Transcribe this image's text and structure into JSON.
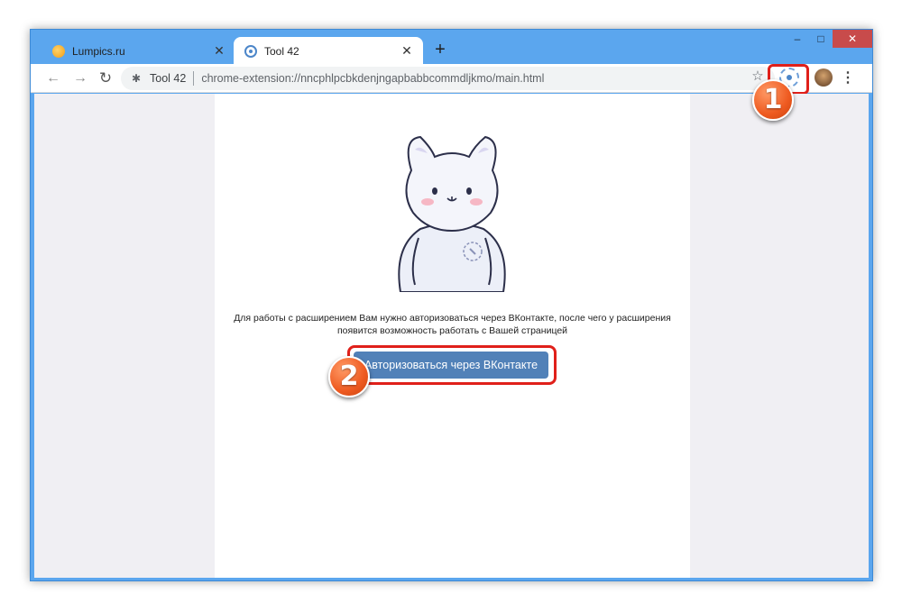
{
  "window": {
    "controls": {
      "minimize": "–",
      "maximize": "□",
      "close": "✕"
    }
  },
  "tabs": [
    {
      "title": "Lumpics.ru",
      "icon": "lumpics-favicon",
      "active": false,
      "close": "✕"
    },
    {
      "title": "Tool 42",
      "icon": "tool42-favicon",
      "active": true,
      "close": "✕"
    }
  ],
  "newtab": "+",
  "toolbar": {
    "back": "←",
    "forward": "→",
    "reload": "↻",
    "star": "☆",
    "menu": "⋮"
  },
  "omnibox": {
    "icon": "puzzle-icon",
    "icon_glyph": "✱",
    "origin": "Tool 42",
    "url": "chrome-extension://nncphlpcbkdenjngapbabbcommdljkmo/main.html"
  },
  "page": {
    "description": "Для работы с расширением Вам нужно авторизоваться через ВКонтакте, после чего у расширения появится возможность работать с Вашей страницей",
    "auth_button": "Авторизоваться через ВКонтакте"
  },
  "badges": {
    "one": "1",
    "two": "2"
  },
  "colors": {
    "titlebar": "#5ba6ee",
    "vk_button": "#5181b8",
    "highlight": "#e0201a",
    "badge": "#ee5a20"
  }
}
